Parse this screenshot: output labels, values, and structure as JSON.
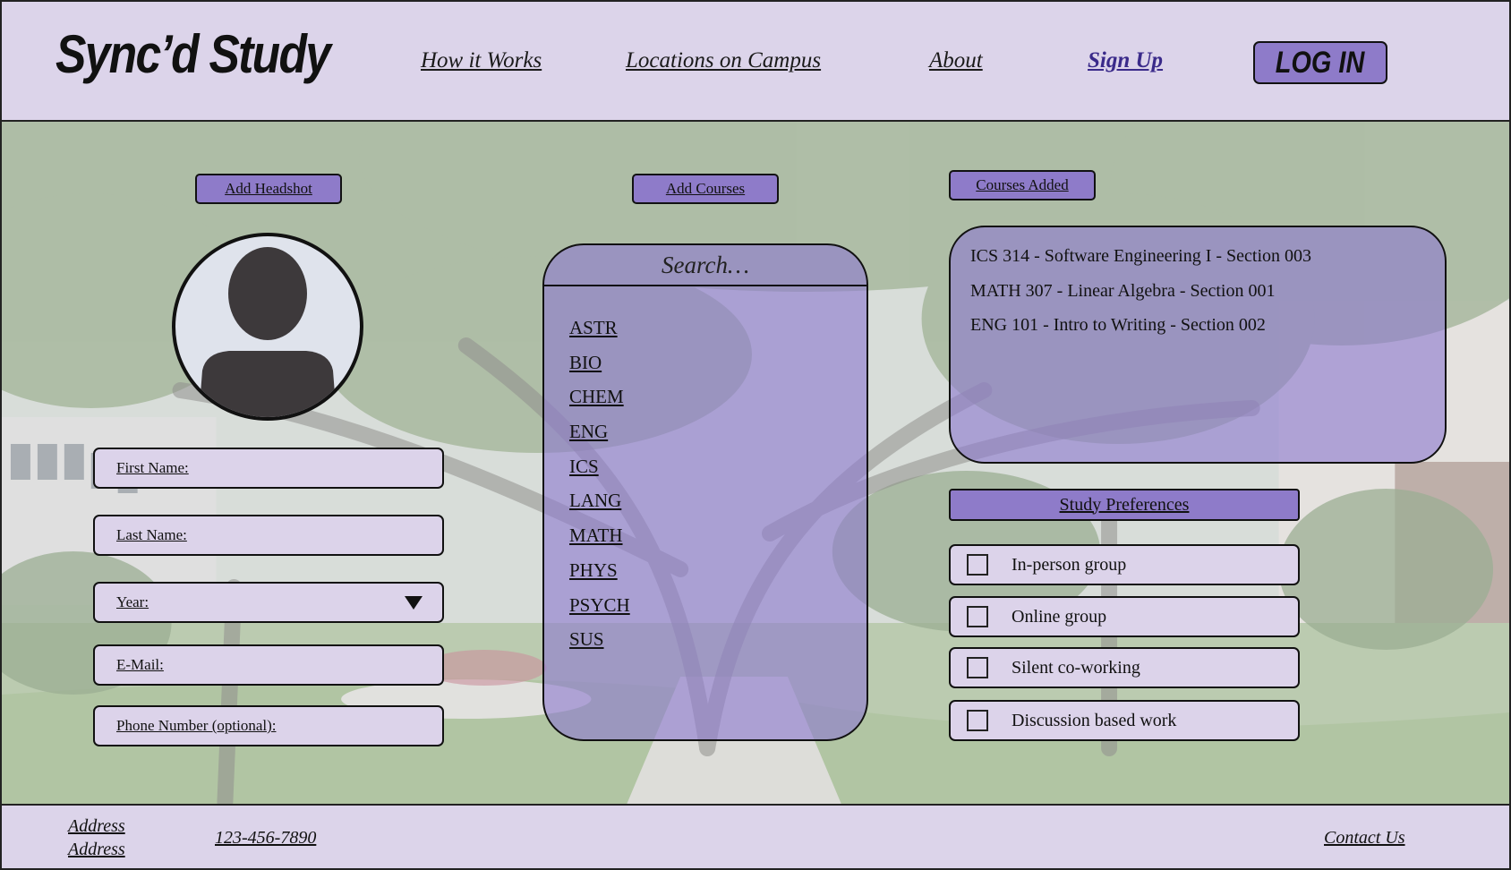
{
  "header": {
    "logo": "Sync’d Study",
    "nav": [
      "How it Works",
      "Locations on Campus",
      "About",
      "Sign Up"
    ],
    "login_label": "LOG IN"
  },
  "profile": {
    "add_headshot_label": "Add Headshot",
    "fields": {
      "first_name": "First Name:",
      "last_name": "Last Name:",
      "year": "Year:",
      "email": "E-Mail:",
      "phone": "Phone Number (optional):"
    }
  },
  "courses": {
    "add_courses_label": "Add Courses",
    "search_placeholder": "Search…",
    "subjects": [
      "ASTR",
      "BIO",
      "CHEM",
      "ENG",
      "ICS",
      "LANG",
      "MATH",
      "PHYS",
      "PSYCH",
      "SUS"
    ],
    "courses_added_label": "Courses Added",
    "added": [
      "ICS 314 - Software Engineering I - Section 003",
      "MATH 307 - Linear Algebra - Section 001",
      "ENG 101 - Intro to Writing - Section 002"
    ]
  },
  "preferences": {
    "title": "Study Preferences",
    "options": [
      "In-person group",
      "Online group",
      "Silent co-working",
      "Discussion based work"
    ]
  },
  "footer": {
    "address_line1": "Address",
    "address_line2": "Address",
    "phone": "123-456-7890",
    "contact": "Contact Us"
  },
  "colors": {
    "accent": "#8e7bc9",
    "panel_light": "#dcd4ea"
  }
}
